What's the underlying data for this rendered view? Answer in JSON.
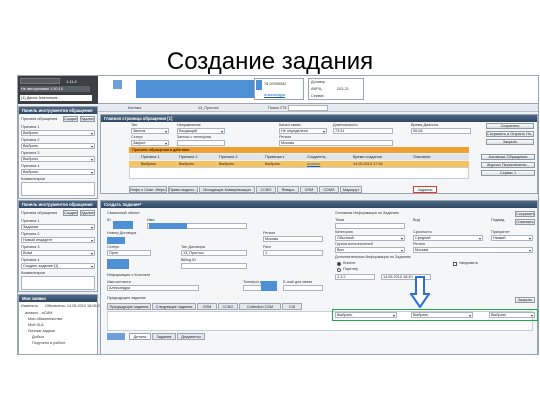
{
  "slide": {
    "title": "Создание задания"
  },
  "phone": {
    "status": "Не авторизован 1:30:14",
    "time": "1:11:2",
    "line": "(1) Денис Анатольев...",
    "row2_a": "Пок",
    "row2_b": "(1)"
  },
  "top_info": {
    "id_value": "78-00995082",
    "contact_name": "Александра",
    "doc_label": "Договор",
    "abon_label": "АВРЦ",
    "service_label": "Сервис",
    "doc_value": "203-21"
  },
  "nav": {
    "contact_label": "Контакт",
    "contact_value": "13_Прогноз",
    "search_label": "Поиск СТК"
  },
  "tools_panel_1": {
    "title": "Панель инструментов обращения",
    "reason_label": "Причина обращения",
    "buttons": [
      "Создать",
      "Удалить"
    ],
    "reasons": [
      {
        "label": "Причина 1",
        "value": "Выбрать"
      },
      {
        "label": "Причина 2",
        "value": "Выбрать"
      },
      {
        "label": "Причина 3",
        "value": "Выбрать"
      },
      {
        "label": "Причина 4",
        "value": "Выбрать"
      }
    ],
    "comment_label": "Комментарии"
  },
  "appeal": {
    "title": "Главная страница обращения [1]",
    "row1": [
      {
        "label": "Тип",
        "value": "Звонок"
      },
      {
        "label": "Направление",
        "value": "Входящий"
      },
      {
        "label": "Канал связи",
        "value": "Не определено"
      },
      {
        "label": "Длительность",
        "value": "73:31"
      },
      {
        "label": "Время Диалога",
        "value": "06:08"
      }
    ],
    "row2": [
      {
        "label": "Статус",
        "value": "Закрыт"
      },
      {
        "label": "Запись с телефона",
        "value": ""
      },
      {
        "label": "Регион",
        "value": "Москва"
      }
    ],
    "save_buttons": [
      "Сохранить",
      "Сохранить и Открыть Но...",
      "Закрыть"
    ],
    "reasons_title": "Причины обращения в действии",
    "grid_headers": [
      "Причина 1",
      "Причина 2",
      "Причина 3",
      "Привязка к",
      "Создатель",
      "Время создания",
      "Описание"
    ],
    "grid_row": [
      "Выбрать",
      "Выбрать",
      "Выбрать",
      "Выбрать",
      "acrasov",
      "14.05.2010 17:34",
      ""
    ],
    "side_buttons": [
      "Активные Обращения",
      "Журнал Переключени...",
      "Сервис 1"
    ],
    "tabs": [
      "Инфо о Сеан. Инфо.",
      "Прямо видеоз...",
      "Исходящие Коммуникации",
      "CCBO",
      "Январь",
      "CRM",
      "CDMS",
      "Маршрут",
      "Задания"
    ]
  },
  "tools_panel_2": {
    "title": "Панель инструментов обращения",
    "reason_label": "Причина обращения",
    "buttons": [
      "Создать",
      "Удалить"
    ],
    "reasons": [
      {
        "label": "Причина 1",
        "value": "Задания"
      },
      {
        "label": "Причина 2",
        "value": "Новый инцидент"
      },
      {
        "label": "Причина 3",
        "value": "Возм"
      },
      {
        "label": "Причина 4",
        "value": "Создать задание [1]"
      }
    ],
    "comment_label": "Комментарии"
  },
  "task": {
    "title": "Создать Задание*",
    "related_label": "Связанный объект",
    "fields": [
      {
        "label": "ID",
        "value": ""
      },
      {
        "label": "Имя",
        "value": ""
      },
      {
        "label": "Номер Договора",
        "value": ""
      },
      {
        "label": "Регион",
        "value": "Москва"
      },
      {
        "label": "Статус",
        "value": "Open"
      },
      {
        "label": "Тип Договора",
        "value": "13_Прогноз"
      },
      {
        "label": "Billing ID",
        "value": ""
      },
      {
        "label": "Ранг",
        "value": "1"
      }
    ],
    "contact_info_label": "Информация о Контакте",
    "contact_name_label": "Имя контакта",
    "contact_name_value": "Александра",
    "phone_label": "Телефон для связи",
    "email_label": "E-mail для связи",
    "classification_title": "Основная Информация по Заданию",
    "class_labels": [
      "Тема",
      "Вид",
      "Подвид"
    ],
    "class_values": [
      "Выбрать",
      "Выбрать",
      "Выбрать"
    ],
    "class_labels_2": [
      "Категория",
      "Срочность",
      "Приоритет"
    ],
    "class_values_2": [
      "Обычный",
      "Средний",
      "Низкий"
    ],
    "group_label": "Группа исполнителей",
    "group_value": "Вип",
    "region_label": "Регион",
    "region_value": "Москва",
    "extra_info_label": "Дополнительная Информация по Заданию",
    "client_option": "Клиент",
    "partner_option": "Партнер",
    "notify_option": "Уведомить",
    "date_value": "14.05.2010 18:40",
    "time_value": "1:1:2",
    "save_buttons": [
      "Сохранить",
      "Отменить"
    ],
    "close_button": "Закрыть",
    "prev_label": "Предыдущее задание",
    "tabs": [
      "Предыдущие задания",
      "Следующие задания",
      "CRM",
      "CCBO",
      "Collection CSM",
      "CIS"
    ],
    "bottom_tabs": [
      "Детали",
      "Задание",
      "Документы"
    ]
  },
  "my_requests": {
    "title": "Мои заявки",
    "toolbar": "Изменить",
    "updated": "Обновлено: 14.05.2010 18:06:29",
    "items": [
      "acrasov - аСИМ",
      "Мои обязательства",
      "Мой SLA",
      "Личные задачи",
      "Добыл",
      "Поручено в работе"
    ]
  }
}
